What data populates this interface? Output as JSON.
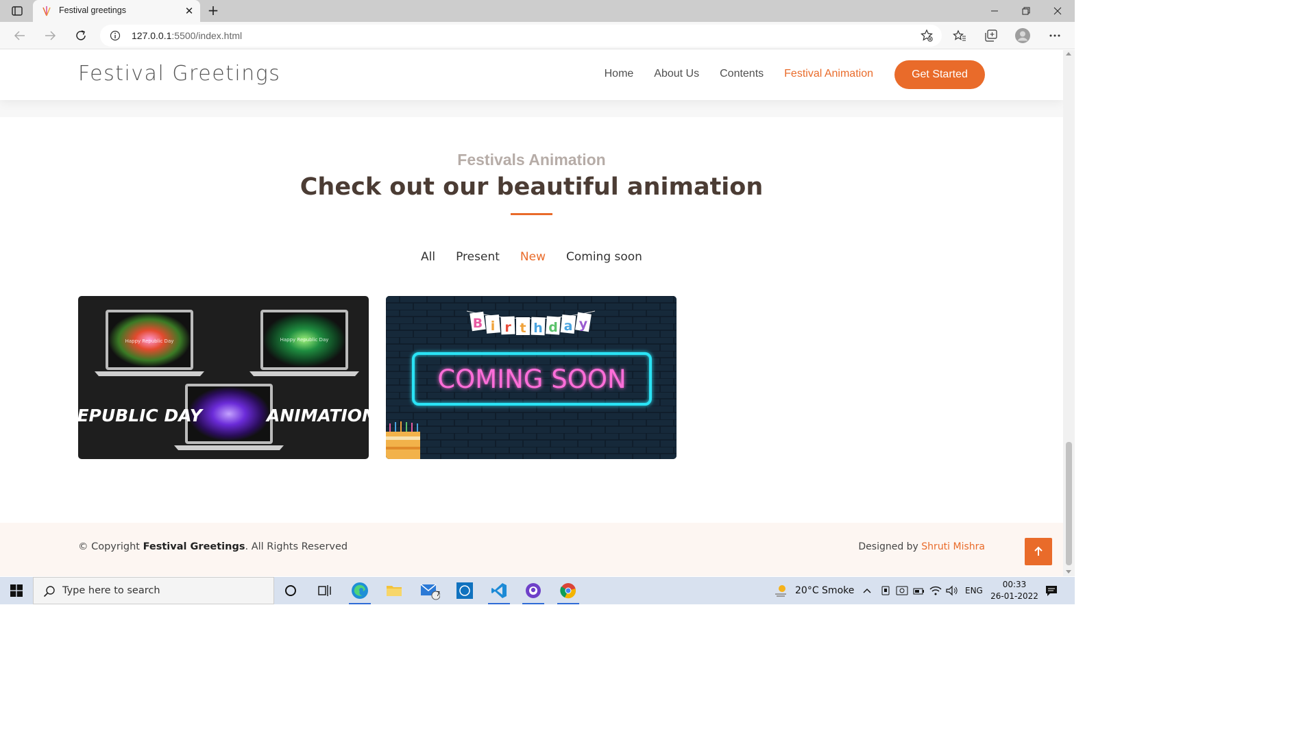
{
  "browser": {
    "tab_title": "Festival greetings",
    "tab_close": "✕",
    "new_tab": "+",
    "url_host": "127.0.0.1",
    "url_rest": ":5500/index.html"
  },
  "site": {
    "logo": "Festival Greetings",
    "nav": {
      "home": "Home",
      "about": "About Us",
      "contents": "Contents",
      "animation": "Festival Animation"
    },
    "cta": "Get Started",
    "accent_color": "#e96b2a"
  },
  "section": {
    "subtitle": "Festivals Animation",
    "title": "Check out our beautiful animation"
  },
  "filters": {
    "all": "All",
    "present": "Present",
    "new": "New",
    "coming_soon": "Coming soon"
  },
  "cards": {
    "card1": {
      "left_text": "REPUBLIC DAY",
      "right_text": "ANIMATION",
      "screen_text_1": "Happy Republic Day",
      "screen_text_2": "Happy Republic Day"
    },
    "card2": {
      "banner_letters": [
        "B",
        "i",
        "r",
        "t",
        "h",
        "d",
        "a",
        "y"
      ],
      "neon_text": "COMING SOON"
    }
  },
  "footer": {
    "copyright_prefix": "© Copyright ",
    "copyright_brand": "Festival Greetings",
    "copyright_suffix": ". All Rights Reserved",
    "designed_by": "Designed by ",
    "designer": "Shruti Mishra"
  },
  "taskbar": {
    "search_placeholder": "Type here to search",
    "mail_badge": "7",
    "weather": "20°C  Smoke",
    "language": "ENG",
    "time": "00:33",
    "date": "26-01-2022"
  }
}
